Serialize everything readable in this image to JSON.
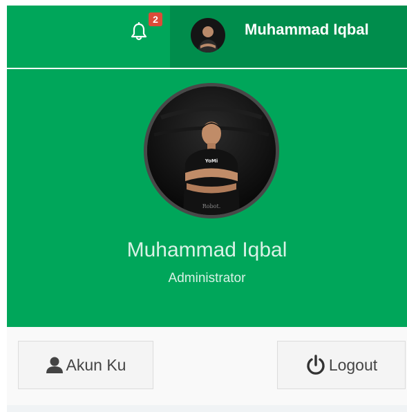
{
  "navbar": {
    "notifications": {
      "icon": "bell-icon",
      "count": "2",
      "badge_color": "#dd4b39"
    },
    "user": {
      "name": "Muhammad Iqbal",
      "avatar_icon": "user-photo"
    },
    "colors": {
      "background": "#00a65a",
      "active": "#008d4c"
    }
  },
  "user_header": {
    "name": "Muhammad Iqbal",
    "role": "Administrator",
    "photo_caption": "Robot."
  },
  "user_footer": {
    "profile_button": {
      "label": "Akun Ku",
      "icon": "user-icon"
    },
    "logout_button": {
      "label": "Logout",
      "icon": "power-icon"
    }
  }
}
